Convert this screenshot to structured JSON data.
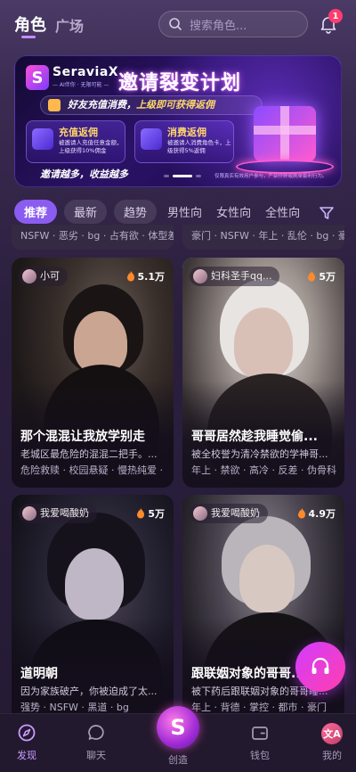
{
  "header": {
    "tab_role": "角色",
    "tab_square": "广场",
    "search_placeholder": "搜索角色...",
    "notification_count": "1"
  },
  "banner": {
    "brand": "SeraviaX",
    "brand_sub": "— AI伴你 · 无限可能 —",
    "title": "邀请裂变计划",
    "subtitle_a": "好友充值消费，",
    "subtitle_b": "上级即可获得返佣",
    "cards": [
      {
        "title": "充值返佣",
        "desc": "被邀请人充值任意金额，上级获得10%佣金"
      },
      {
        "title": "消费返佣",
        "desc": "被邀请人消费角色卡，上级获得5%返佣"
      }
    ],
    "footer": "邀请越多，收益越多",
    "note": "仅限真实有效用户参与，严禁作弊或刷单套利行为。",
    "slide_count": 3,
    "slide_active": 1
  },
  "filters": {
    "chips": [
      "推荐",
      "最新",
      "趋势",
      "男性向",
      "女性向",
      "全性向"
    ],
    "active_index": 0
  },
  "previous_row": [
    {
      "tags": "NSFW · 恶劣 · bg · 占有欲 · 体型差"
    },
    {
      "tags": "豪门 · NSFW · 年上 · 乱伦 · bg · 豪门"
    }
  ],
  "cards": [
    {
      "author": "小可",
      "likes": "5.1万",
      "title": "那个混混让我放学别走",
      "desc": "老城区最危险的混混二把手。...",
      "tags": "危险救赎 · 校园悬疑 · 慢热纯爱 · 暗"
    },
    {
      "author": "妇科圣手qq...",
      "likes": "5万",
      "title": "哥哥居然趁我睡觉偷...",
      "desc": "被全校誉为清冷禁欲的学神哥...",
      "tags": "年上 · 禁欲 · 高冷 · 反差 · 伪骨科"
    },
    {
      "author": "我爱喝酸奶",
      "likes": "5万",
      "title": "道明朝",
      "desc": "因为家族破产，你被迫成了太...",
      "tags": "强势 · NSFW · 黑道 · bg"
    },
    {
      "author": "我爱喝酸奶",
      "likes": "4.9万",
      "title": "跟联姻对象的哥哥...",
      "desc": "被下药后跟联姻对象的哥哥睡...",
      "tags": "年上 · 背德 · 掌控 · 都市 · 豪门"
    }
  ],
  "nav": {
    "discover": "发现",
    "chat": "聊天",
    "create": "创造",
    "wallet": "钱包",
    "me": "我的"
  },
  "colors": {
    "accent": "#8a5cf0",
    "badge": "#ff3d6e",
    "fab": "#d23cff"
  }
}
